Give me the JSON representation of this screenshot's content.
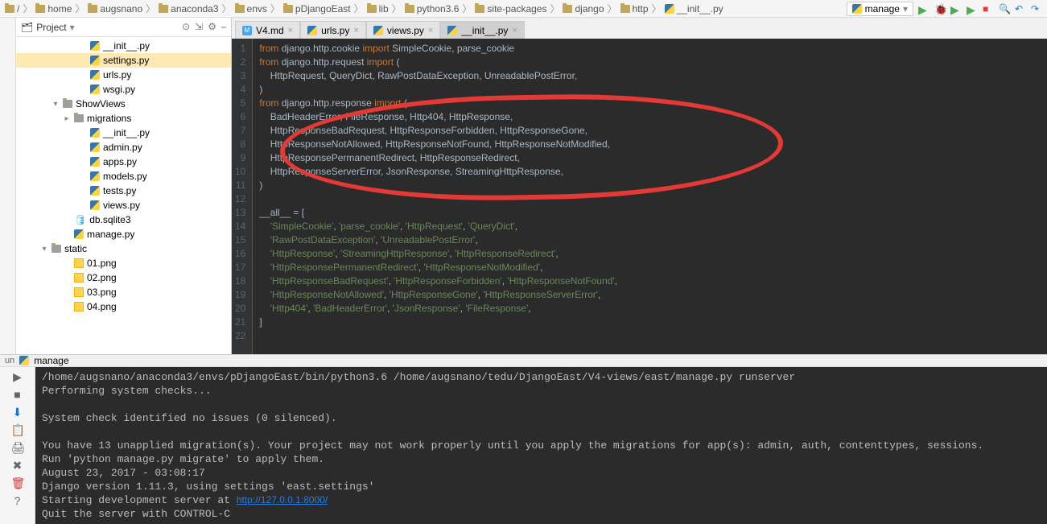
{
  "breadcrumbs": [
    "/",
    "home",
    "augsnano",
    "anaconda3",
    "envs",
    "pDjangoEast",
    "lib",
    "python3.6",
    "site-packages",
    "django",
    "http",
    "__init__.py"
  ],
  "runConfig": "manage",
  "sidebar": {
    "title": "Project",
    "items": [
      {
        "pad": 78,
        "icon": "py",
        "name": "__init__.py"
      },
      {
        "pad": 78,
        "icon": "py",
        "name": "settings.py",
        "sel": true
      },
      {
        "pad": 78,
        "icon": "py",
        "name": "urls.py"
      },
      {
        "pad": 78,
        "icon": "py",
        "name": "wsgi.py"
      },
      {
        "pad": 44,
        "icon": "folder",
        "name": "ShowViews",
        "arrow": "▾"
      },
      {
        "pad": 58,
        "icon": "folder",
        "name": "migrations",
        "arrow": "▸"
      },
      {
        "pad": 78,
        "icon": "py",
        "name": "__init__.py"
      },
      {
        "pad": 78,
        "icon": "py",
        "name": "admin.py"
      },
      {
        "pad": 78,
        "icon": "py",
        "name": "apps.py"
      },
      {
        "pad": 78,
        "icon": "py",
        "name": "models.py"
      },
      {
        "pad": 78,
        "icon": "py",
        "name": "tests.py"
      },
      {
        "pad": 78,
        "icon": "py",
        "name": "views.py"
      },
      {
        "pad": 58,
        "icon": "db",
        "name": "db.sqlite3"
      },
      {
        "pad": 58,
        "icon": "py",
        "name": "manage.py"
      },
      {
        "pad": 30,
        "icon": "folder",
        "name": "static",
        "arrow": "▾"
      },
      {
        "pad": 58,
        "icon": "img",
        "name": "01.png"
      },
      {
        "pad": 58,
        "icon": "img",
        "name": "02.png"
      },
      {
        "pad": 58,
        "icon": "img",
        "name": "03.png"
      },
      {
        "pad": 58,
        "icon": "img",
        "name": "04.png"
      }
    ]
  },
  "tabs": [
    {
      "icon": "md",
      "label": "V4.md"
    },
    {
      "icon": "py",
      "label": "urls.py"
    },
    {
      "icon": "py",
      "label": "views.py"
    },
    {
      "icon": "py",
      "label": "__init__.py",
      "active": true
    }
  ],
  "code": {
    "lines": [
      {
        "n": 1,
        "html": "<span class='kw'>from</span> django.http.cookie <span class='kw'>import</span> SimpleCookie<span class='nm'>,</span> parse_cookie"
      },
      {
        "n": 2,
        "html": "<span class='kw'>from</span> django.http.request <span class='kw'>import</span> ("
      },
      {
        "n": 3,
        "html": "    HttpRequest<span class='nm'>,</span> QueryDict<span class='nm'>,</span> RawPostDataException<span class='nm'>,</span> UnreadablePostError<span class='nm'>,</span>"
      },
      {
        "n": 4,
        "html": ")"
      },
      {
        "n": 5,
        "html": "<span class='kw'>from</span> django.http.response <span class='kw'>import</span> ("
      },
      {
        "n": 6,
        "html": "    BadHeaderError<span class='nm'>,</span> FileResponse<span class='nm'>,</span> Http404<span class='nm'>,</span> HttpResponse<span class='nm'>,</span>"
      },
      {
        "n": 7,
        "html": "    HttpResponseBadRequest<span class='nm'>,</span> HttpResponseForbidden<span class='nm'>,</span> HttpResponseGone<span class='nm'>,</span>"
      },
      {
        "n": 8,
        "html": "    HttpResponseNotAllowed<span class='nm'>,</span> HttpResponseNotFound<span class='nm'>,</span> HttpResponseNotModified<span class='nm'>,</span>"
      },
      {
        "n": 9,
        "html": "    HttpResponsePermanentRedirect<span class='nm'>,</span> HttpResponseRedirect<span class='nm'>,</span>"
      },
      {
        "n": 10,
        "html": "    HttpResponseServerError<span class='nm'>,</span> JsonResponse<span class='nm'>,</span> StreamingHttpResponse<span class='nm'>,</span>"
      },
      {
        "n": 11,
        "html": ")"
      },
      {
        "n": 12,
        "html": ""
      },
      {
        "n": 13,
        "html": "__all__ = ["
      },
      {
        "n": 14,
        "html": "    <span class='str'>'SimpleCookie'</span><span class='nm'>,</span> <span class='str'>'parse_cookie'</span><span class='nm'>,</span> <span class='str'>'HttpRequest'</span><span class='nm'>,</span> <span class='str'>'QueryDict'</span><span class='nm'>,</span>"
      },
      {
        "n": 15,
        "html": "    <span class='str'>'RawPostDataException'</span><span class='nm'>,</span> <span class='str'>'UnreadablePostError'</span><span class='nm'>,</span>"
      },
      {
        "n": 16,
        "html": "    <span class='str'>'HttpResponse'</span><span class='nm'>,</span> <span class='str'>'StreamingHttpResponse'</span><span class='nm'>,</span> <span class='str'>'HttpResponseRedirect'</span><span class='nm'>,</span>"
      },
      {
        "n": 17,
        "html": "    <span class='str'>'HttpResponsePermanentRedirect'</span><span class='nm'>,</span> <span class='str'>'HttpResponseNotModified'</span><span class='nm'>,</span>"
      },
      {
        "n": 18,
        "html": "    <span class='str'>'HttpResponseBadRequest'</span><span class='nm'>,</span> <span class='str'>'HttpResponseForbidden'</span><span class='nm'>,</span> <span class='str'>'HttpResponseNotFound'</span><span class='nm'>,</span>"
      },
      {
        "n": 19,
        "html": "    <span class='str'>'HttpResponseNotAllowed'</span><span class='nm'>,</span> <span class='str'>'HttpResponseGone'</span><span class='nm'>,</span> <span class='str'>'HttpResponseServerError'</span><span class='nm'>,</span>"
      },
      {
        "n": 20,
        "html": "    <span class='str'>'Http404'</span><span class='nm'>,</span> <span class='str'>'BadHeaderError'</span><span class='nm'>,</span> <span class='str'>'JsonResponse'</span><span class='nm'>,</span> <span class='str'>'FileResponse'</span><span class='nm'>,</span>"
      },
      {
        "n": 21,
        "html": "]"
      },
      {
        "n": 22,
        "html": ""
      }
    ]
  },
  "run": {
    "tab": "manage",
    "lines": [
      "/home/augsnano/anaconda3/envs/pDjangoEast/bin/python3.6 /home/augsnano/tedu/DjangoEast/V4-views/east/manage.py runserver",
      "Performing system checks...",
      "",
      "System check identified no issues (0 silenced).",
      "",
      "You have 13 unapplied migration(s). Your project may not work properly until you apply the migrations for app(s): admin, auth, contenttypes, sessions.",
      "Run 'python manage.py migrate' to apply them.",
      "August 23, 2017 - 03:08:17",
      "Django version 1.11.3, using settings 'east.settings'",
      "Starting development server at <a>http://127.0.0.1:8000/</a>",
      "Quit the server with CONTROL-C"
    ]
  }
}
